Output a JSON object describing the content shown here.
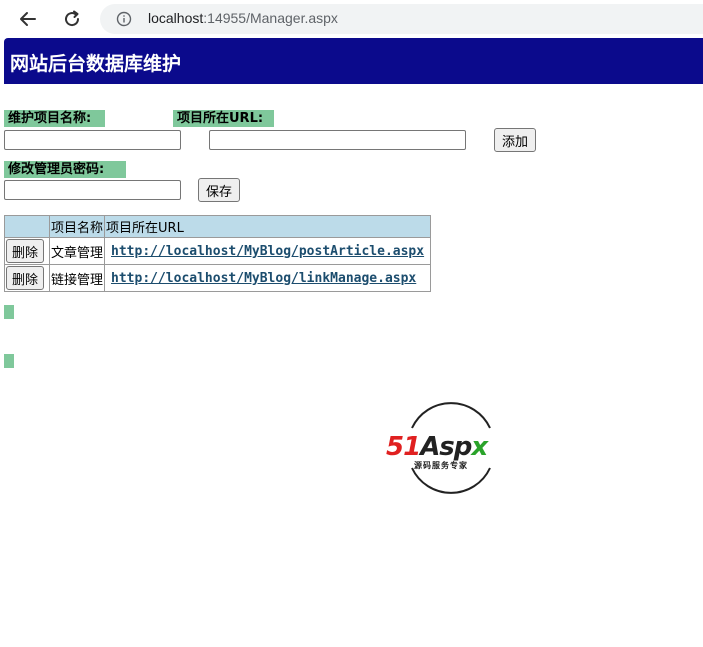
{
  "browser": {
    "url_host": "localhost",
    "url_rest": ":14955/Manager.aspx"
  },
  "page": {
    "banner_title": "网站后台数据库维护",
    "label_item_name": "维护项目名称:",
    "label_item_url": "项目所在URL:",
    "add_button": "添加",
    "label_password": "修改管理员密码:",
    "save_button": "保存",
    "item_name_value": "",
    "item_url_value": "",
    "password_value": ""
  },
  "table": {
    "headers": [
      "",
      "项目名称",
      "项目所在URL"
    ],
    "rows": [
      {
        "action": "删除",
        "name": "文章管理",
        "url": "http://localhost/MyBlog/postArticle.aspx"
      },
      {
        "action": "删除",
        "name": "链接管理",
        "url": "http://localhost/MyBlog/linkManage.aspx"
      }
    ]
  },
  "logo": {
    "part1": "51",
    "part2": "Asp",
    "part3": "x",
    "subtitle": "源码服务专家"
  },
  "colors": {
    "banner": "#0b0a8c",
    "label_bg": "#7fc89b",
    "table_header": "#bcdbe9",
    "link": "#1c4d6e"
  }
}
